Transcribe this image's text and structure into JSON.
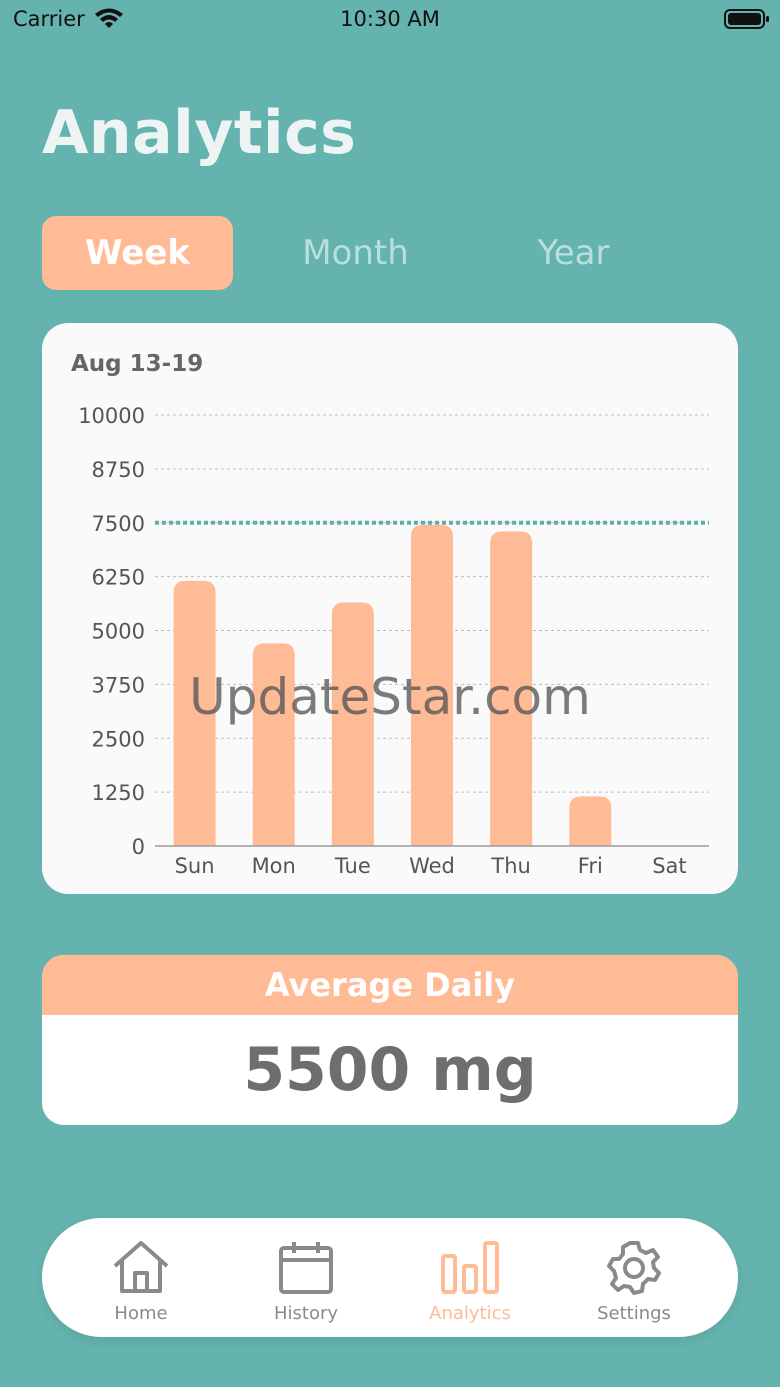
{
  "status_bar": {
    "carrier": "Carrier",
    "time": "10:30 AM"
  },
  "page_title": "Analytics",
  "segments": {
    "week": "Week",
    "month": "Month",
    "year": "Year",
    "selected": "Week"
  },
  "chart_data": {
    "type": "bar",
    "title": "Aug 13-19",
    "categories": [
      "Sun",
      "Mon",
      "Tue",
      "Wed",
      "Thu",
      "Fri",
      "Sat"
    ],
    "values": [
      6150,
      4700,
      5650,
      7450,
      7300,
      1150,
      0
    ],
    "y_ticks": [
      0,
      1250,
      2500,
      3750,
      5000,
      6250,
      7500,
      8750,
      10000
    ],
    "ylim": [
      0,
      10000
    ],
    "goal_line": 7500,
    "grid": true,
    "colors": {
      "bar": "#ffbb96",
      "goal": "#5ab1ab",
      "grid": "#bdbdbd"
    }
  },
  "average": {
    "label": "Average Daily",
    "value": "5500 mg"
  },
  "watermark": "UpdateStar.com",
  "tabs": [
    {
      "label": "Home",
      "icon": "home-icon"
    },
    {
      "label": "History",
      "icon": "calendar-icon"
    },
    {
      "label": "Analytics",
      "icon": "bar-chart-icon"
    },
    {
      "label": "Settings",
      "icon": "gear-icon"
    }
  ],
  "colors": {
    "background": "#65b3ae",
    "accent": "#ffbb96",
    "inactive": "#8a8a8a"
  }
}
